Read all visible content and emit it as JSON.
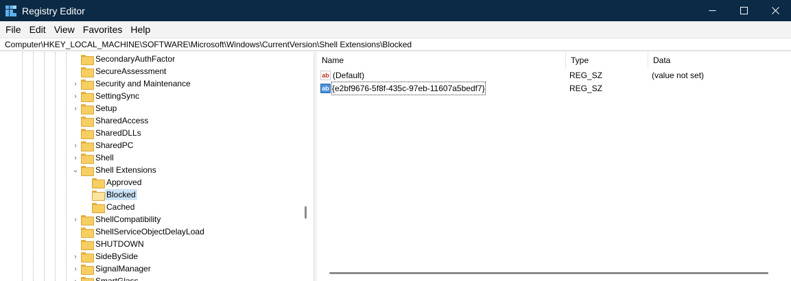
{
  "window": {
    "title": "Registry Editor",
    "controls": {
      "minimize": "—",
      "maximize": "☐",
      "close": "✕"
    }
  },
  "menu": [
    "File",
    "Edit",
    "View",
    "Favorites",
    "Help"
  ],
  "address": "Computer\\HKEY_LOCAL_MACHINE\\SOFTWARE\\Microsoft\\Windows\\CurrentVersion\\Shell Extensions\\Blocked",
  "tree": {
    "nodes": [
      {
        "label": "SecondaryAuthFactor",
        "expander": "",
        "selected": false
      },
      {
        "label": "SecureAssessment",
        "expander": "",
        "selected": false
      },
      {
        "label": "Security and Maintenance",
        "expander": "›",
        "selected": false
      },
      {
        "label": "SettingSync",
        "expander": "›",
        "selected": false
      },
      {
        "label": "Setup",
        "expander": "›",
        "selected": false
      },
      {
        "label": "SharedAccess",
        "expander": "",
        "selected": false
      },
      {
        "label": "SharedDLLs",
        "expander": "",
        "selected": false
      },
      {
        "label": "SharedPC",
        "expander": "›",
        "selected": false
      },
      {
        "label": "Shell",
        "expander": "›",
        "selected": false
      },
      {
        "label": "Shell Extensions",
        "expander": "⌄",
        "selected": false
      },
      {
        "label": "Approved",
        "expander": "",
        "selected": false
      },
      {
        "label": "Blocked",
        "expander": "",
        "selected": true
      },
      {
        "label": "Cached",
        "expander": "",
        "selected": false
      },
      {
        "label": "ShellCompatibility",
        "expander": "›",
        "selected": false
      },
      {
        "label": "ShellServiceObjectDelayLoad",
        "expander": "",
        "selected": false
      },
      {
        "label": "SHUTDOWN",
        "expander": "",
        "selected": false
      },
      {
        "label": "SideBySide",
        "expander": "›",
        "selected": false
      },
      {
        "label": "SignalManager",
        "expander": "›",
        "selected": false
      },
      {
        "label": "SmartGlass",
        "expander": "›",
        "selected": false
      }
    ]
  },
  "list": {
    "columns": [
      "Name",
      "Type",
      "Data"
    ],
    "rows": [
      {
        "name": "(Default)",
        "type": "REG_SZ",
        "data": "(value not set)",
        "icon": "string-value-icon"
      },
      {
        "name": "{e2bf9676-5f8f-435c-97eb-11607a5bedf7}",
        "type": "REG_SZ",
        "data": "",
        "icon": "string-value-icon"
      }
    ],
    "icon_text": "ab"
  },
  "colors": {
    "titlebar": "#0b2a45",
    "selection": "#cce4f7",
    "folder": "#f6ce62"
  }
}
